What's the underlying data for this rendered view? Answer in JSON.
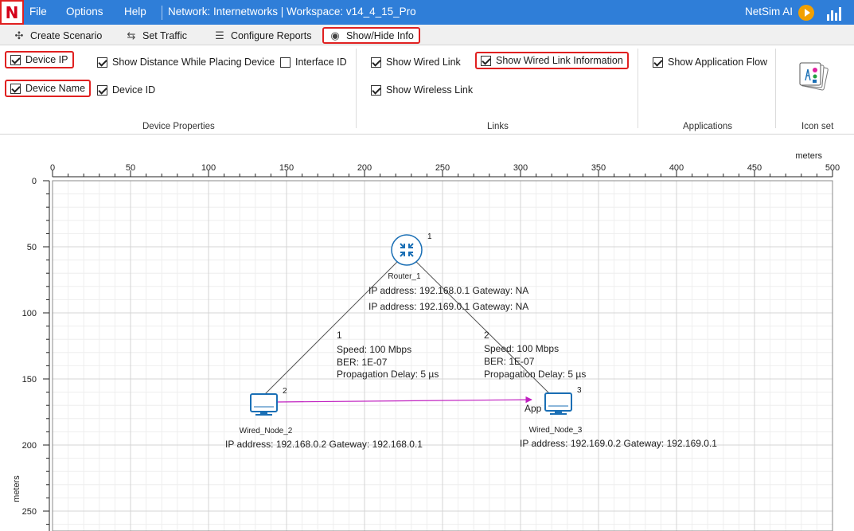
{
  "menubar": {
    "logo_letter": "N",
    "file": "File",
    "options": "Options",
    "help": "Help",
    "title": "Network: Internetworks | Workspace: v14_4_15_Pro",
    "ai": "NetSim AI",
    "brand_color": "#2f7ed8"
  },
  "tabs": [
    {
      "label": "Create Scenario",
      "icon": "create-scenario-icon"
    },
    {
      "label": "Set Traffic",
      "icon": "set-traffic-icon"
    },
    {
      "label": "Configure Reports",
      "icon": "configure-reports-icon"
    },
    {
      "label": "Show/Hide Info",
      "icon": "show-hide-info-icon",
      "active": true
    }
  ],
  "ribbon": {
    "device_properties": {
      "group_label": "Device Properties",
      "device_ip": {
        "label": "Device IP",
        "checked": true
      },
      "device_name": {
        "label": "Device Name",
        "checked": true
      },
      "show_distance": {
        "label": "Show Distance While Placing Device",
        "checked": true
      },
      "device_id": {
        "label": "Device ID",
        "checked": true
      },
      "interface_id": {
        "label": "Interface ID",
        "checked": false
      }
    },
    "links": {
      "group_label": "Links",
      "show_wired_link": {
        "label": "Show Wired Link",
        "checked": true
      },
      "show_wireless_link": {
        "label": "Show Wireless Link",
        "checked": true
      },
      "show_wired_link_info": {
        "label": "Show Wired Link Information",
        "checked": true
      }
    },
    "applications": {
      "group_label": "Applications",
      "show_app_flow": {
        "label": "Show Application Flow",
        "checked": true
      }
    },
    "icon_set": {
      "group_label": "Icon set"
    }
  },
  "canvas": {
    "unit_label": "meters",
    "x_ticks": [
      0,
      50,
      100,
      150,
      200,
      250,
      300,
      350,
      400,
      450,
      500
    ],
    "y_ticks": [
      0,
      50,
      100,
      150,
      200,
      250
    ],
    "router": {
      "name": "Router_1",
      "id": "1",
      "ip1": "IP address: 192.168.0.1 Gateway: NA",
      "ip2": "IP address: 192.169.0.1 Gateway: NA"
    },
    "node2": {
      "name": "Wired_Node_2",
      "id": "2",
      "ip": "IP address: 192.168.0.2 Gateway: 192.168.0.1"
    },
    "node3": {
      "name": "Wired_Node_3",
      "id": "3",
      "ip": "IP address: 192.169.0.2 Gateway: 192.169.0.1"
    },
    "link1": {
      "id": "1",
      "speed": "Speed: 100 Mbps",
      "ber": "BER: 1E-07",
      "delay": "Propagation Delay: 5 µs"
    },
    "link2": {
      "id": "2",
      "speed": "Speed: 100 Mbps",
      "ber": "BER: 1E-07",
      "delay": "Propagation Delay: 5 µs"
    },
    "app_label": "App",
    "app_flow_color": "#c020c0",
    "device_color": "#1a6fb5"
  }
}
